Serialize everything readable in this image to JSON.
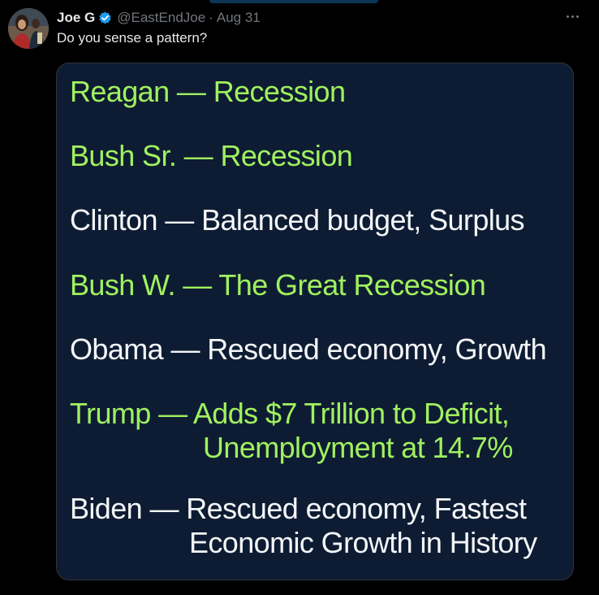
{
  "author": {
    "display_name": "Joe G",
    "handle": "@EastEndJoe",
    "separator": "·",
    "date": "Aug 31",
    "verified": true,
    "verified_color": "#1d9bf0"
  },
  "tweet": {
    "text": "Do you sense a pattern?"
  },
  "media": {
    "background_color": "#0e1c33",
    "green_color": "#a0f15f",
    "lines": [
      {
        "text": "Reagan — Recession",
        "color": "green"
      },
      {
        "text": "Bush Sr. — Recession",
        "color": "green"
      },
      {
        "text": "Clinton — Balanced budget, Surplus",
        "color": "white"
      },
      {
        "text": "Bush W. — The Great Recession",
        "color": "green"
      },
      {
        "text": "Obama — Rescued economy, Growth",
        "color": "white"
      },
      {
        "text": "Trump — Adds $7 Trillion to Deficit,",
        "continuation": "Unemployment at 14.7%",
        "color": "green"
      },
      {
        "text": "Biden — Rescued economy,  Fastest",
        "continuation": "Economic Growth in History",
        "color": "white"
      }
    ]
  },
  "icons": {
    "more": "more-options-icon",
    "verified": "verified-badge-icon"
  }
}
